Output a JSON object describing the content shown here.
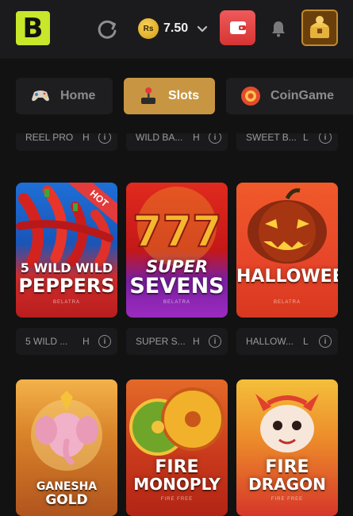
{
  "header": {
    "logo_letter": "B",
    "balance": {
      "currency_symbol": "Rs",
      "amount": "7.50"
    },
    "icons": {
      "refresh": "refresh-icon",
      "chevron": "chevron-down-icon",
      "wallet": "wallet-icon",
      "bell": "bell-icon",
      "avatar": "avatar-treasure-icon"
    }
  },
  "tabs": [
    {
      "label": "Home",
      "icon": "gamepad-icon",
      "active": false
    },
    {
      "label": "Slots",
      "icon": "joystick-icon",
      "active": true
    },
    {
      "label": "CoinGame",
      "icon": "coin-chip-icon",
      "active": false
    }
  ],
  "top_labels": [
    {
      "name": "REEL PRO",
      "provider": "H"
    },
    {
      "name": "WILD BA...",
      "provider": "H"
    },
    {
      "name": "SWEET B...",
      "provider": "L"
    }
  ],
  "games_row1": [
    {
      "title_line1": "5 WILD WILD",
      "title_line2": "PEPPERS",
      "sub": "BELATRA",
      "badge": "HOT"
    },
    {
      "title_line1": "SUPER",
      "title_line2": "SEVENS",
      "sub": "BELATRA",
      "badge": ""
    },
    {
      "title_line1": "HALLOWEEN",
      "title_line2": "",
      "sub": "BELATRA",
      "badge": ""
    }
  ],
  "row1_labels": [
    {
      "name": "5 WILD ...",
      "provider": "H"
    },
    {
      "name": "SUPER S...",
      "provider": "H"
    },
    {
      "name": "HALLOW...",
      "provider": "L"
    }
  ],
  "games_row2": [
    {
      "title_line1": "GANESHA",
      "title_line2": "GOLD",
      "sub": ""
    },
    {
      "title_line1": "FIRE",
      "title_line2": "MONOPLY",
      "sub": "FIRE FREE"
    },
    {
      "title_line1": "FIRE",
      "title_line2": "DRAGON",
      "sub": "FIRE FREE"
    }
  ],
  "colors": {
    "accent": "#c89642",
    "background": "#121212",
    "logo": "#c8e62a",
    "wallet": "#e04545"
  }
}
